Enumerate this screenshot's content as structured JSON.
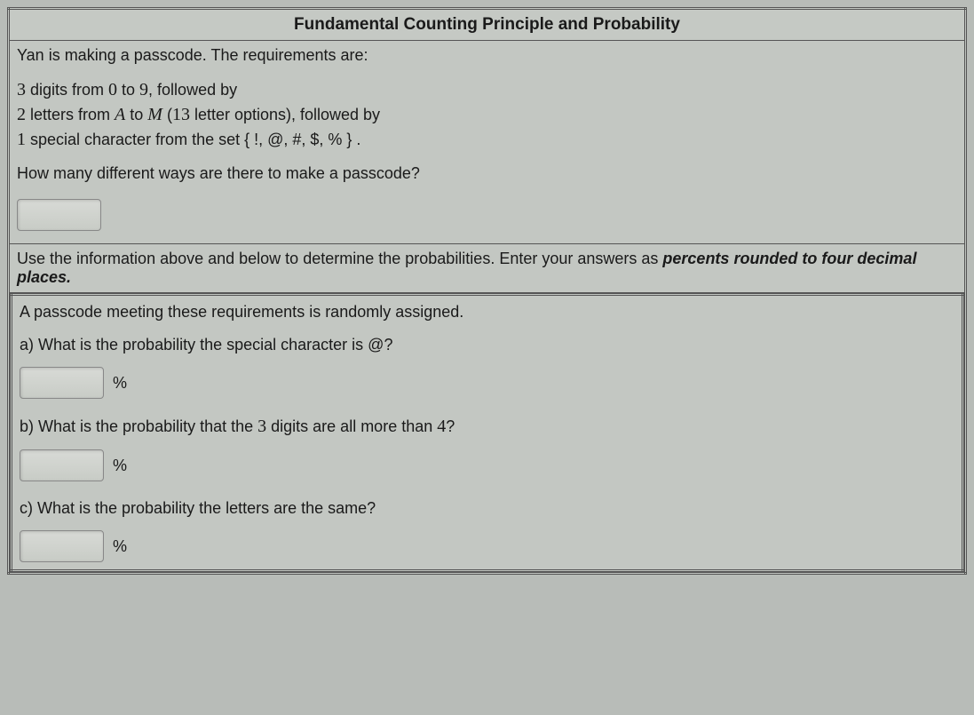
{
  "title": "Fundamental Counting Principle and Probability",
  "section1": {
    "intro": "Yan is making a passcode. The requirements are:",
    "req1_a": "3",
    "req1_b": " digits from ",
    "req1_c": "0",
    "req1_d": " to ",
    "req1_e": "9",
    "req1_f": ", followed by",
    "req2_a": "2",
    "req2_b": " letters from ",
    "req2_c": "A",
    "req2_d": " to ",
    "req2_e": "M",
    "req2_f": " (",
    "req2_g": "13",
    "req2_h": " letter options), followed by",
    "req3_a": "1",
    "req3_b": " special character from the set { !, @, #, $, % } .",
    "question": "How many different ways are there to make a passcode?"
  },
  "instruction": {
    "text1": "Use the information above and below to determine the probabilities. Enter your answers as ",
    "emphasis": "percents rounded to four decimal places."
  },
  "section2": {
    "intro": "A passcode meeting these requirements is randomly assigned.",
    "parta_label": "a) What is the probability the special character is @?",
    "partb_pre": "b) What is the probability that the ",
    "partb_num": "3",
    "partb_mid": " digits are all more than ",
    "partb_num2": "4",
    "partb_post": "?",
    "partc_label": "c) What is the probability the letters are the same?",
    "percent": "%"
  }
}
